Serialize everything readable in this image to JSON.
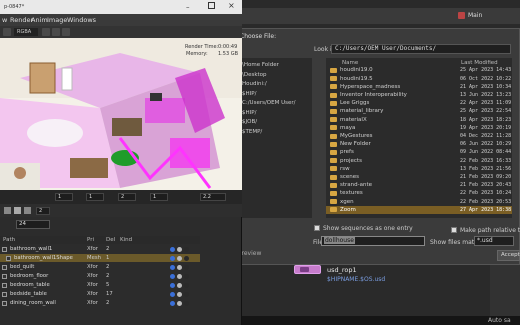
{
  "main_app": {
    "title": "Main",
    "auto_label": "Auto sa"
  },
  "dialog": {
    "title": "Choose File:",
    "look_in_label": "Look in",
    "look_in_value": "C:/Users/OEM User/Documents/",
    "favorites": [
      "\\Home Folder",
      "\\Desktop",
      "Houdini:/",
      "$HIP/",
      "C:/Users/OEM User/",
      "$HIP/",
      "$JOB/",
      "$TEMP/"
    ],
    "columns": {
      "name": "Name",
      "modified": "Last Modified"
    },
    "files": [
      {
        "name": "houdini19.0",
        "date": "25 Apr 2023 14:43"
      },
      {
        "name": "houdini19.5",
        "date": "06 Oct 2022 10:22"
      },
      {
        "name": "Hyperspace_madness",
        "date": "21 Apr 2023 10:34"
      },
      {
        "name": "Inventor Interoperability",
        "date": "13 Jun 2022 13:23"
      },
      {
        "name": "Lee Griggs",
        "date": "22 Apr 2023 11:09"
      },
      {
        "name": "material_library",
        "date": "25 Apr 2023 22:54"
      },
      {
        "name": "materialX",
        "date": "18 Apr 2023 18:23"
      },
      {
        "name": "maya",
        "date": "19 Apr 2023 20:19"
      },
      {
        "name": "MyGestures",
        "date": "04 Dec 2022 11:28"
      },
      {
        "name": "New Folder",
        "date": "06 Jun 2022 10:29"
      },
      {
        "name": "prefs",
        "date": "09 Jun 2022 08:44"
      },
      {
        "name": "projects",
        "date": "22 Feb 2023 16:33"
      },
      {
        "name": "rsw",
        "date": "13 Feb 2023 21:56"
      },
      {
        "name": "scenes",
        "date": "21 Feb 2023 09:20"
      },
      {
        "name": "strand-ante",
        "date": "21 Feb 2023 20:43"
      },
      {
        "name": "textures",
        "date": "22 Feb 2023 10:24"
      },
      {
        "name": "xgen",
        "date": "22 Feb 2023 20:53"
      },
      {
        "name": "Zoom",
        "date": "27 Apr 2023 18:38"
      }
    ],
    "selected_index": 17,
    "seq_label": "Show sequences as one entry",
    "rel_label": "Make path relative to cu",
    "file_label": "File",
    "file_value": "dollhouse",
    "match_label": "Show files matching",
    "match_value": "*.usd",
    "preview_label": "Preview",
    "accept_label": "Accept"
  },
  "usd_node": {
    "name": "usd_rop1",
    "path": "$HIPNAME.$OS.usd"
  },
  "houdini": {
    "title": "p-0847*",
    "menus": [
      "w",
      "Render",
      "Anim",
      "Image",
      "Windows"
    ],
    "rgba": "RGBA",
    "render_time_label": "Render Time:",
    "render_time": "0:00:49",
    "memory_label": "Memory:",
    "memory": "1.53 GB",
    "frame": "24",
    "slot_values": [
      "1",
      "1",
      "2",
      "1",
      "2.2"
    ],
    "play_values": [
      "2"
    ],
    "scene_columns": [
      "Path",
      "Pri",
      "Del",
      "Kind"
    ],
    "scene_rows": [
      {
        "name": "bathroom_wall1",
        "pri": "Xfor",
        "del": "2",
        "indent": 0
      },
      {
        "name": "bathroom_wall1Shape",
        "pri": "Mesh",
        "del": "1",
        "indent": 1
      },
      {
        "name": "bed_quilt",
        "pri": "Xfor",
        "del": "2",
        "indent": 0
      },
      {
        "name": "bedroom_floor",
        "pri": "Xfor",
        "del": "2",
        "indent": 0
      },
      {
        "name": "bedroom_table",
        "pri": "Xfor",
        "del": "5",
        "indent": 0
      },
      {
        "name": "bedside_table",
        "pri": "Xfor",
        "del": "17",
        "indent": 0
      },
      {
        "name": "dining_room_wall",
        "pri": "Xfor",
        "del": "2",
        "indent": 0
      }
    ]
  }
}
